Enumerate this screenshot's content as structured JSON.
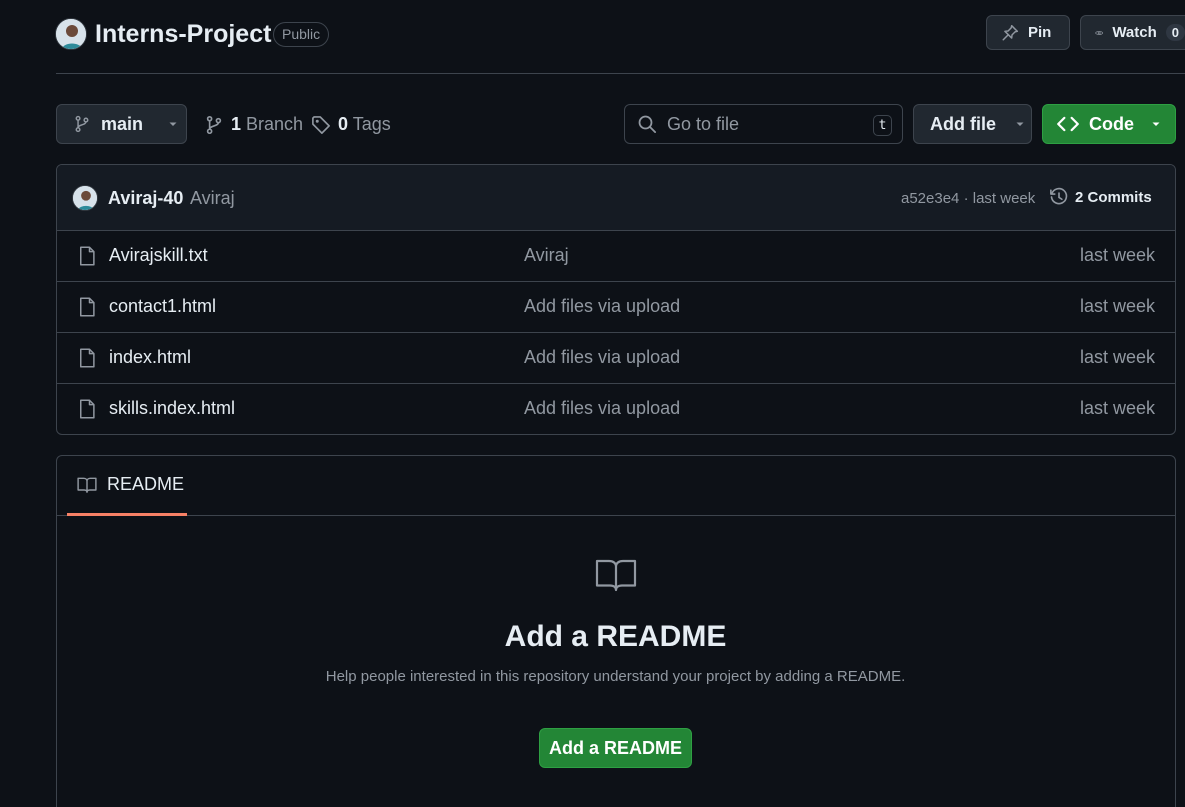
{
  "header": {
    "repo_name": "Interns-Project",
    "visibility": "Public",
    "pin_label": "Pin",
    "watch_label": "Watch",
    "watch_count": "0"
  },
  "toolbar": {
    "branch": "main",
    "branch_count": "1",
    "branch_label": "Branch",
    "tag_count": "0",
    "tag_label": "Tags",
    "search_placeholder": "Go to file",
    "search_shortcut": "t",
    "add_file_label": "Add file",
    "code_label": "Code"
  },
  "commit": {
    "author": "Aviraj-40",
    "message": "Aviraj",
    "hash": "a52e3e4",
    "separator": "·",
    "time": "last week",
    "commits_label": "2 Commits"
  },
  "files": [
    {
      "name": "Avirajskill.txt",
      "message": "Aviraj",
      "time": "last week"
    },
    {
      "name": "contact1.html",
      "message": "Add files via upload",
      "time": "last week"
    },
    {
      "name": "index.html",
      "message": "Add files via upload",
      "time": "last week"
    },
    {
      "name": "skills.index.html",
      "message": "Add files via upload",
      "time": "last week"
    }
  ],
  "readme": {
    "tab_label": "README",
    "heading": "Add a README",
    "description": "Help people interested in this repository understand your project by adding a README.",
    "button_label": "Add a README"
  },
  "colors": {
    "background": "#0d1117",
    "border": "#3d444d",
    "primary_button": "#238636",
    "tab_underline": "#f78166",
    "muted_text": "#9198a1"
  }
}
